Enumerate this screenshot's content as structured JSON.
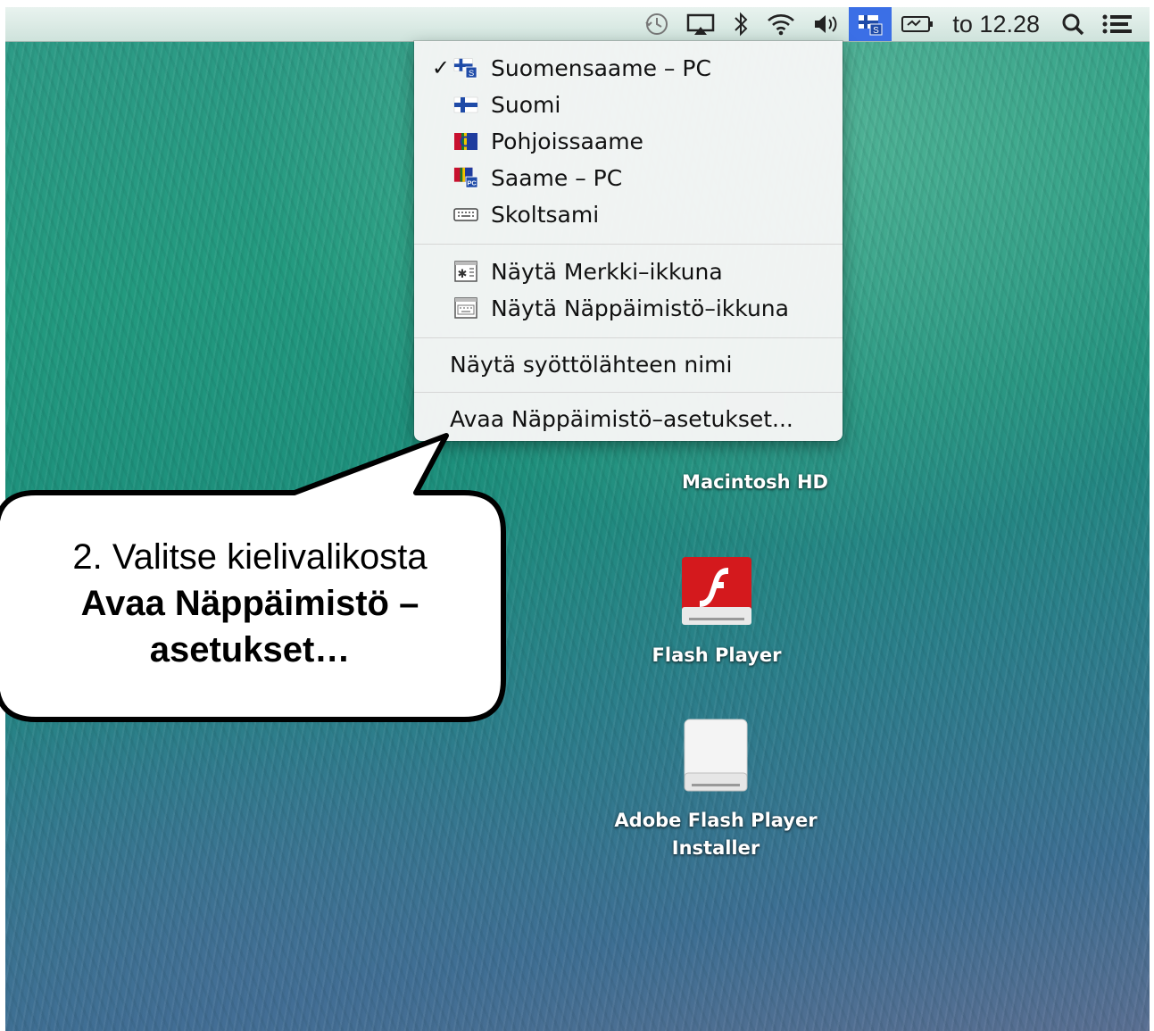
{
  "menubar": {
    "clock": "to 12.28",
    "icons": [
      "time-machine-icon",
      "airplay-icon",
      "bluetooth-icon",
      "wifi-icon",
      "volume-icon",
      "input-source-flag-icon",
      "battery-icon",
      "spotlight-icon",
      "notification-center-icon"
    ],
    "active_color": "#3b6fe6"
  },
  "input_menu": {
    "sources": [
      {
        "label": "Suomensaame – PC",
        "checked": true,
        "icon": "finnish-flag-s-icon"
      },
      {
        "label": "Suomi",
        "checked": false,
        "icon": "finnish-flag-icon"
      },
      {
        "label": "Pohjoissaame",
        "checked": false,
        "icon": "sami-flag-icon"
      },
      {
        "label": "Saame – PC",
        "checked": false,
        "icon": "sami-flag-pc-icon"
      },
      {
        "label": "Skoltsami",
        "checked": false,
        "icon": "keyboard-icon"
      }
    ],
    "check_mark": "✓",
    "viewers": [
      {
        "label": "Näytä Merkki–ikkuna",
        "icon": "character-viewer-icon"
      },
      {
        "label": "Näytä Näppäimistö–ikkuna",
        "icon": "keyboard-viewer-icon"
      }
    ],
    "show_name": "Näytä syöttölähteen nimi",
    "open_prefs": "Avaa Näppäimistö–asetukset..."
  },
  "desktop_icons": {
    "hd": "Macintosh HD",
    "flash": "Flash Player",
    "installer_line1": "Adobe Flash Player",
    "installer_line2": "Installer"
  },
  "callout": {
    "line1": "2. Valitse kielivalikosta",
    "line2": "Avaa Näppäimistö –",
    "line3": "asetukset…"
  }
}
